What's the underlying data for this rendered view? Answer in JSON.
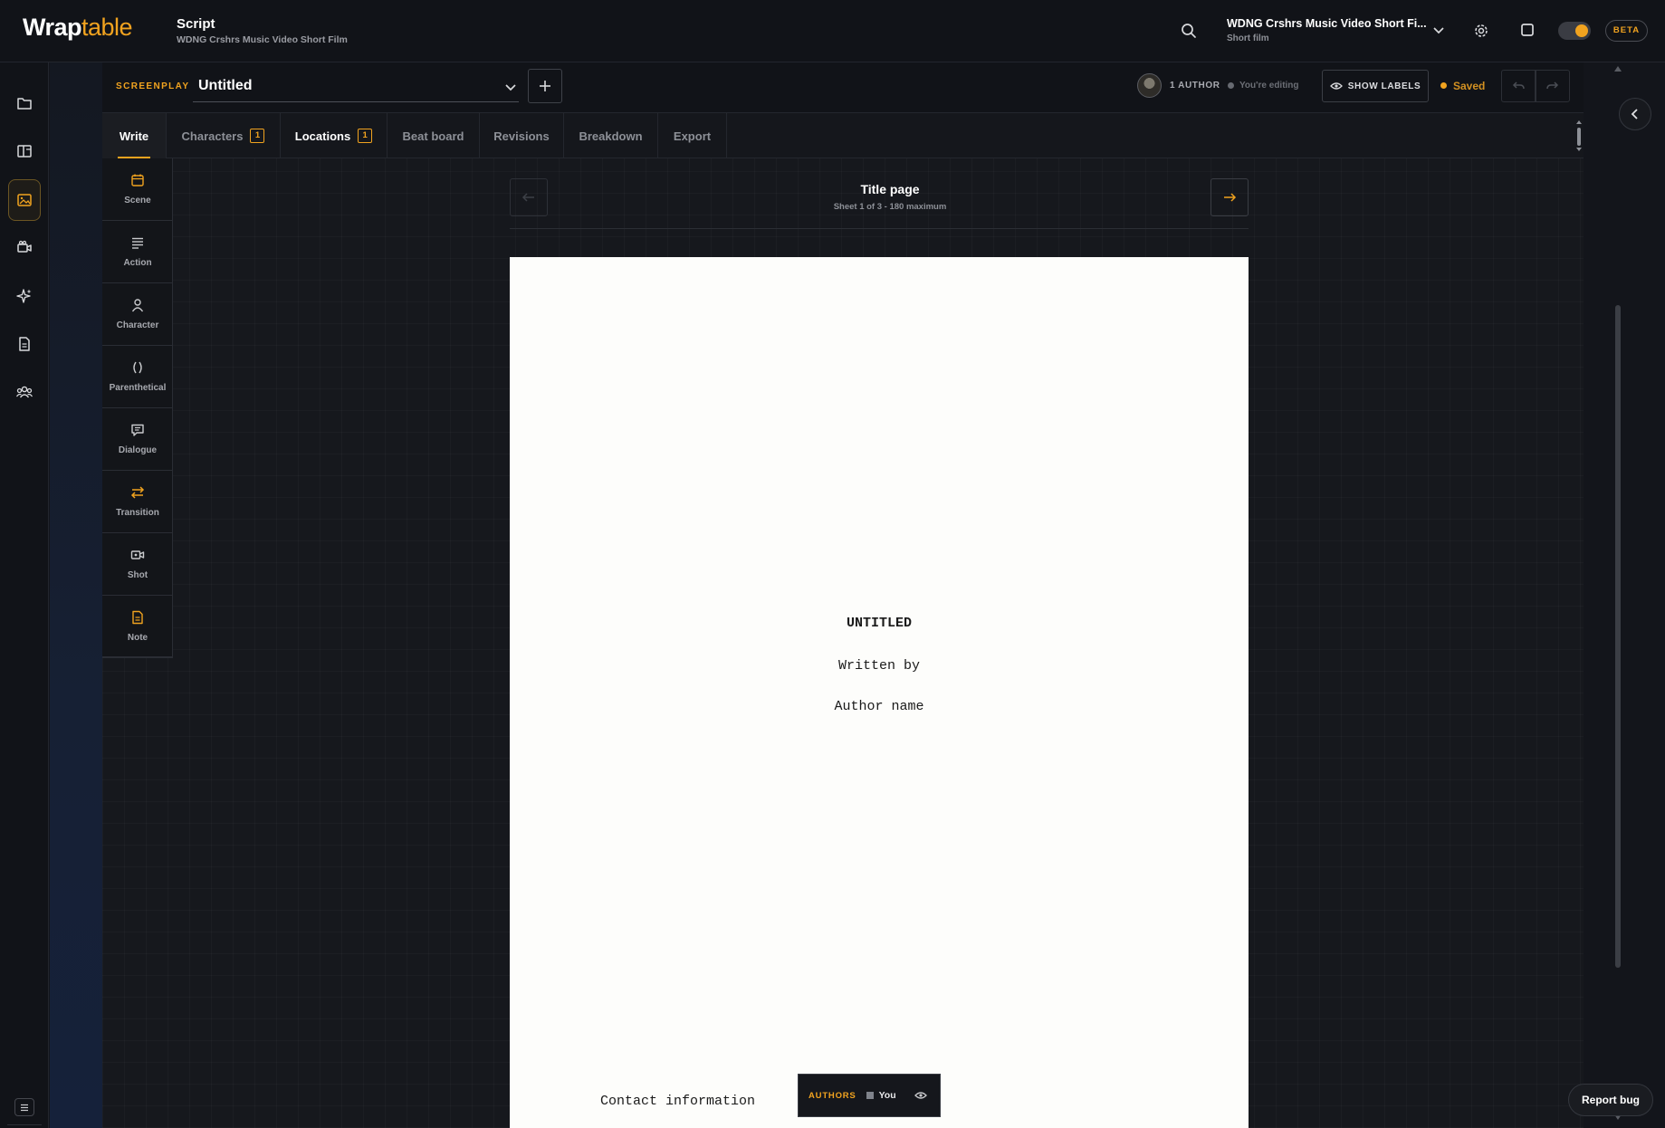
{
  "brand": {
    "bold": "Wrap",
    "thin": "table"
  },
  "app": {
    "title": "Script",
    "subtitle": "WDNG Crshrs Music Video Short Film"
  },
  "project": {
    "name": "WDNG Crshrs Music Video Short Fi...",
    "type": "Short film"
  },
  "beta_label": "BETA",
  "screenplay": {
    "label": "SCREENPLAY",
    "title": "Untitled",
    "author_count": "1 AUTHOR",
    "editing_status": "You're editing",
    "show_labels": "SHOW LABELS",
    "save_status": "Saved"
  },
  "tabs": [
    {
      "label": "Write"
    },
    {
      "label": "Characters",
      "badge": "1"
    },
    {
      "label": "Locations",
      "badge": "1"
    },
    {
      "label": "Beat board"
    },
    {
      "label": "Revisions"
    },
    {
      "label": "Breakdown"
    },
    {
      "label": "Export"
    }
  ],
  "tools": [
    {
      "label": "Scene",
      "icon": "calendar-icon"
    },
    {
      "label": "Action",
      "icon": "lines-icon"
    },
    {
      "label": "Character",
      "icon": "person-icon"
    },
    {
      "label": "Parenthetical",
      "icon": "parentheses-icon"
    },
    {
      "label": "Dialogue",
      "icon": "speech-bubble-icon"
    },
    {
      "label": "Transition",
      "icon": "swap-arrows-icon"
    },
    {
      "label": "Shot",
      "icon": "camera-icon"
    },
    {
      "label": "Note",
      "icon": "note-icon"
    }
  ],
  "page_nav": {
    "title": "Title page",
    "subtitle": "Sheet 1 of 3 - 180 maximum"
  },
  "title_page": {
    "title": "UNTITLED",
    "written_by": "Written by",
    "author": "Author name",
    "contact": "Contact information"
  },
  "authors_popup": {
    "label": "AUTHORS",
    "name": "You"
  },
  "report_bug": "Report bug",
  "colors": {
    "accent": "#f1a31f",
    "background": "#16181d",
    "paper": "#fdfdfb"
  }
}
